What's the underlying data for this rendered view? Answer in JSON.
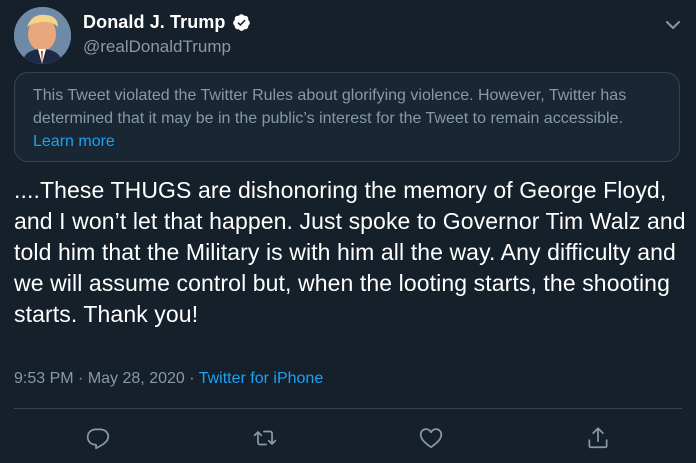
{
  "author": {
    "display_name": "Donald J. Trump",
    "handle": "@realDonaldTrump",
    "verified": true
  },
  "notice": {
    "text": "This Tweet violated the Twitter Rules about glorifying violence. However, Twitter has determined that it may be in the public’s interest for the Tweet to remain accessible.",
    "link_label": "Learn more"
  },
  "tweet": {
    "text": "....These THUGS are dishonoring the memory of George Floyd, and I won’t let that happen. Just spoke to Governor Tim Walz and told him that the Military is with him all the way. Any difficulty and we will assume control but, when the looting starts, the shooting starts. Thank you!"
  },
  "meta": {
    "time": "9:53 PM",
    "separator": "·",
    "date": "May 28, 2020",
    "source": "Twitter for iPhone"
  },
  "icons": {
    "verified": "verified-badge-icon",
    "menu": "chevron-down-icon",
    "reply": "reply-icon",
    "retweet": "retweet-icon",
    "like": "heart-icon",
    "share": "share-icon"
  },
  "colors": {
    "background": "#15202b",
    "accent": "#1da1f2",
    "secondary_text": "#8899a6",
    "border": "#38444d"
  }
}
